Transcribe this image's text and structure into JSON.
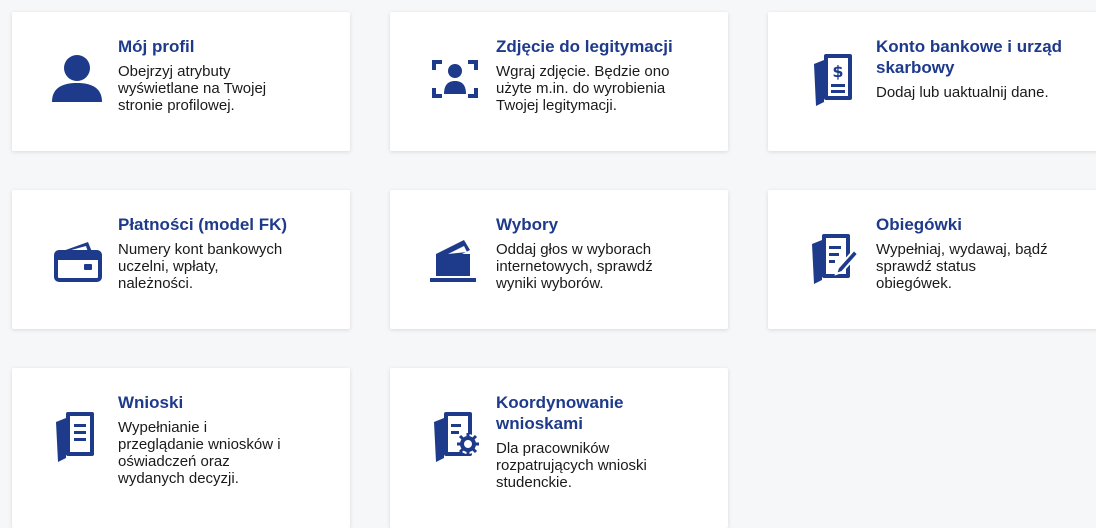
{
  "tiles": [
    {
      "icon": "user-icon",
      "title": "Mój profil",
      "description": "Obejrzyj atrybuty\nwyświetlane na Twojej\nstronie profilowej."
    },
    {
      "icon": "id-photo-icon",
      "title": "Zdjęcie do legitymacji",
      "description": "Wgraj zdjęcie. Będzie ono\nużyte m.in. do wyrobienia\nTwojej legitymacji."
    },
    {
      "icon": "bank-document-icon",
      "title": "Konto bankowe i urząd\nskarbowy",
      "description": "Dodaj lub uaktualnij dane."
    },
    {
      "icon": "wallet-icon",
      "title": "Płatności (model FK)",
      "description": "Numery kont bankowych\nuczelni, wpłaty,\nnależności."
    },
    {
      "icon": "ballot-box-icon",
      "title": "Wybory",
      "description": "Oddaj głos w wyborach\ninternetowych, sprawdź\nwyniki wyborów."
    },
    {
      "icon": "document-edit-icon",
      "title": "Obiegówki",
      "description": "Wypełniaj, wydawaj, bądź\nsprawdź status\nobiegówek."
    },
    {
      "icon": "documents-icon",
      "title": "Wnioski",
      "description": "Wypełnianie i\nprzeglądanie wniosków i\noświadczeń oraz\nwydanych decyzji."
    },
    {
      "icon": "document-settings-icon",
      "title": "Koordynowanie\nwnioskami",
      "description": "Dla pracowników\nrozpatrujących wnioski\nstudenckie."
    }
  ],
  "colors": {
    "accent": "#1e3a8a",
    "text": "#1a1a1a",
    "tile_bg": "#ffffff",
    "page_bg": "#f6f7f9"
  }
}
